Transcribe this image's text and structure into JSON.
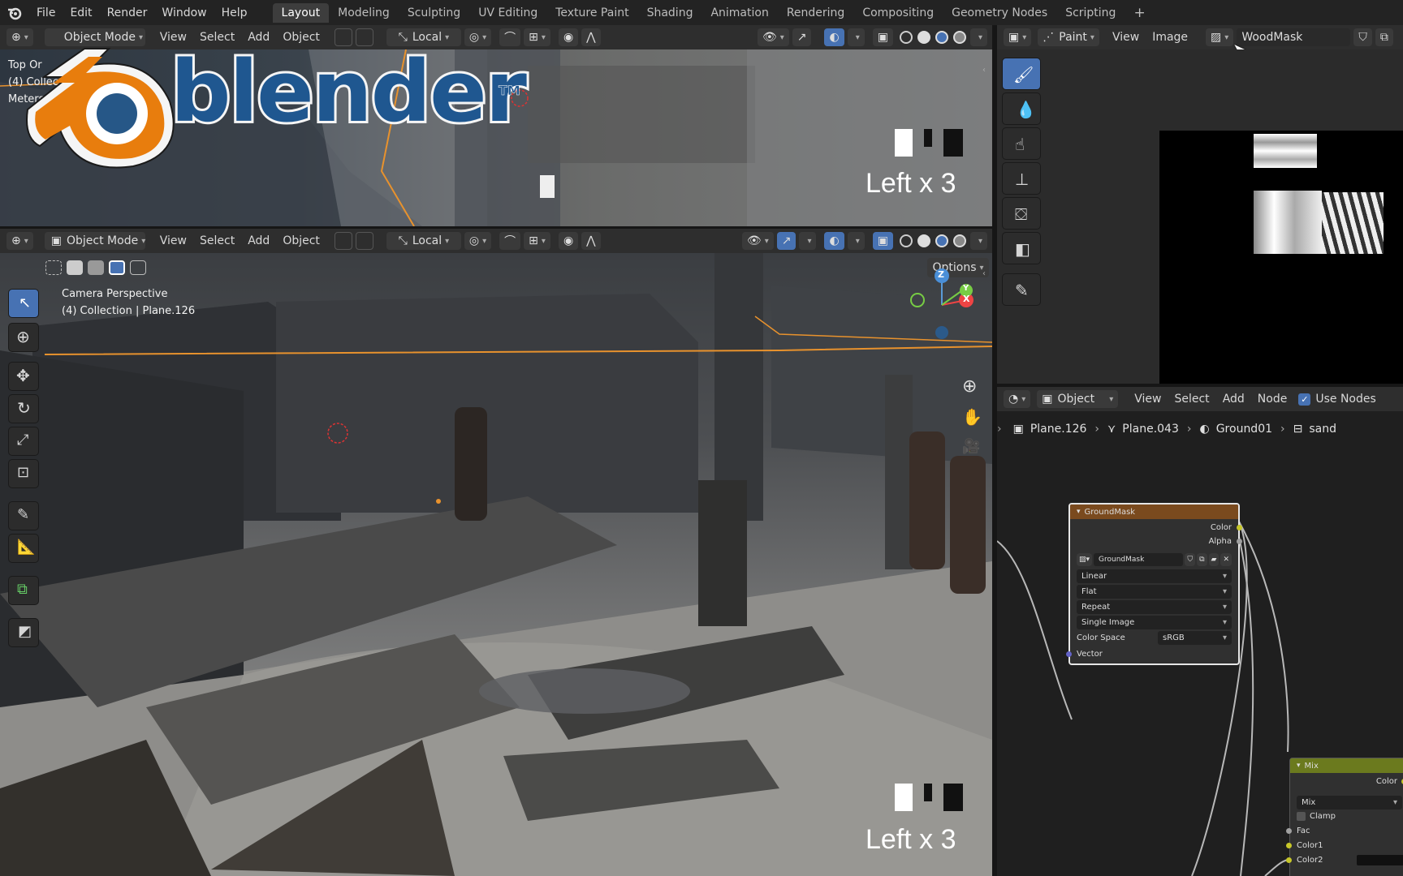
{
  "topbar": {
    "menus": [
      "File",
      "Edit",
      "Render",
      "Window",
      "Help"
    ],
    "workspaces": [
      "Layout",
      "Modeling",
      "Sculpting",
      "UV Editing",
      "Texture Paint",
      "Shading",
      "Animation",
      "Rendering",
      "Compositing",
      "Geometry Nodes",
      "Scripting"
    ],
    "add_tab": "+"
  },
  "top_viewport": {
    "header": {
      "mode": "Object Mode",
      "menus": [
        "View",
        "Select",
        "Add",
        "Object"
      ],
      "transform": "Local"
    },
    "overlay_lines": [
      "Top Or",
      "(4) Collec",
      "Meters"
    ],
    "key_label": "Left x 3"
  },
  "main_viewport": {
    "header": {
      "mode": "Object Mode",
      "menus": [
        "View",
        "Select",
        "Add",
        "Object"
      ],
      "transform": "Local",
      "options": "Options"
    },
    "overlay_lines": [
      "Camera Perspective",
      "(4) Collection | Plane.126"
    ],
    "key_label": "Left x 3",
    "gizmo": {
      "z": "Z",
      "y": "Y",
      "x": "X"
    }
  },
  "logo": {
    "text": "blender",
    "tm": "TM"
  },
  "image_editor": {
    "mode": "Paint",
    "menus": [
      "View",
      "Image"
    ],
    "image_name": "WoodMask"
  },
  "node_editor": {
    "header": {
      "type": "Object",
      "menus": [
        "View",
        "Select",
        "Add",
        "Node"
      ],
      "use_nodes": "Use Nodes"
    },
    "breadcrumbs": [
      "Plane.126",
      "Plane.043",
      "Ground01",
      "sand"
    ],
    "image_node": {
      "title": "GroundMask",
      "outputs": [
        "Color",
        "Alpha"
      ],
      "image": "GroundMask",
      "interpolation": "Linear",
      "projection": "Flat",
      "extension": "Repeat",
      "source": "Single Image",
      "color_space_label": "Color Space",
      "color_space": "sRGB",
      "input": "Vector"
    },
    "mix_node": {
      "title": "Mix",
      "output": "Color",
      "blend": "Mix",
      "clamp": "Clamp",
      "inputs": [
        "Fac",
        "Color1",
        "Color2"
      ]
    }
  },
  "colors": {
    "accent": "#4772b3",
    "selection": "#e8922d",
    "node_image_header": "#7a4a1e",
    "node_mix_header": "#6b7a1e"
  }
}
